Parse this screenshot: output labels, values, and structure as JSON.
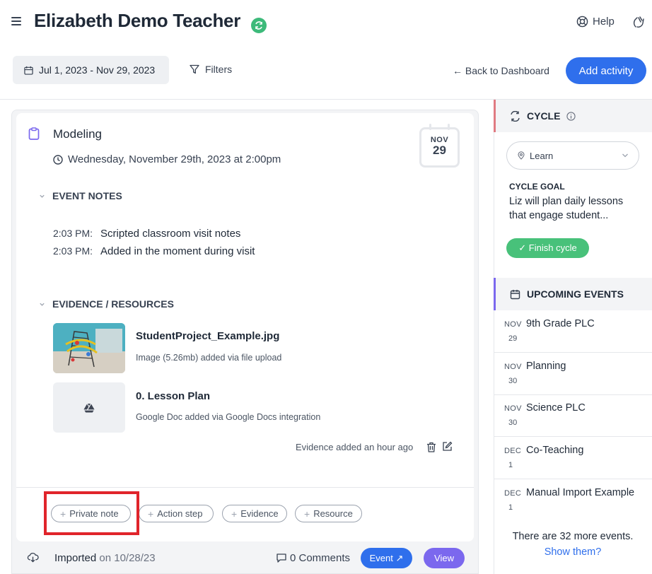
{
  "header": {
    "title": "Elizabeth Demo Teacher",
    "help_label": "Help"
  },
  "toolbar": {
    "date_range": "Jul 1, 2023 - Nov 29, 2023",
    "filters_label": "Filters",
    "back_label": "← Back to Dashboard",
    "add_activity_label": "Add activity"
  },
  "activity": {
    "title": "Modeling",
    "datetime": "Wednesday, November 29th, 2023 at 2:00pm",
    "calendar_month": "NOV",
    "calendar_day": "29",
    "notes_heading": "EVENT NOTES",
    "notes": [
      {
        "time": "2:03 PM:",
        "text": "Scripted classroom visit notes"
      },
      {
        "time": "2:03 PM:",
        "text": "Added in the moment during visit"
      }
    ],
    "evidence_heading": "EVIDENCE / RESOURCES",
    "files": [
      {
        "name": "StudentProject_Example.jpg",
        "desc": "Image (5.26mb) added via file upload"
      },
      {
        "name": "0. Lesson Plan",
        "desc": "Google Doc added via Google Docs integration"
      }
    ],
    "evidence_meta": "Evidence added an hour ago",
    "chips": {
      "private_note": "Private note",
      "action_step": "Action step",
      "evidence": "Evidence",
      "resource": "Resource"
    },
    "footer": {
      "imported": "Imported",
      "imported_date": "on 10/28/23",
      "comments": "0 Comments",
      "event_label": "Event ↗",
      "view_label": "View"
    }
  },
  "sidebar": {
    "cycle_heading": "CYCLE",
    "cycle_select": "Learn",
    "goal_label": "CYCLE GOAL",
    "goal_text": "Liz will plan daily lessons that engage student...",
    "finish_label": "✓  Finish cycle",
    "upcoming_heading": "UPCOMING EVENTS",
    "events": [
      {
        "month": "NOV",
        "day": "29",
        "name": "9th Grade PLC"
      },
      {
        "month": "NOV",
        "day": "30",
        "name": "Planning"
      },
      {
        "month": "NOV",
        "day": "30",
        "name": "Science PLC"
      },
      {
        "month": "DEC",
        "day": "1",
        "name": "Co-Teaching"
      },
      {
        "month": "DEC",
        "day": "1",
        "name": "Manual Import Example"
      }
    ],
    "more_events": "There are 32 more events.",
    "show_them": "Show them?"
  },
  "colors": {
    "primary": "#2f6fec",
    "view_purple": "#7b68ee",
    "success_green": "#48c17a",
    "highlight_red": "#e0242b"
  }
}
